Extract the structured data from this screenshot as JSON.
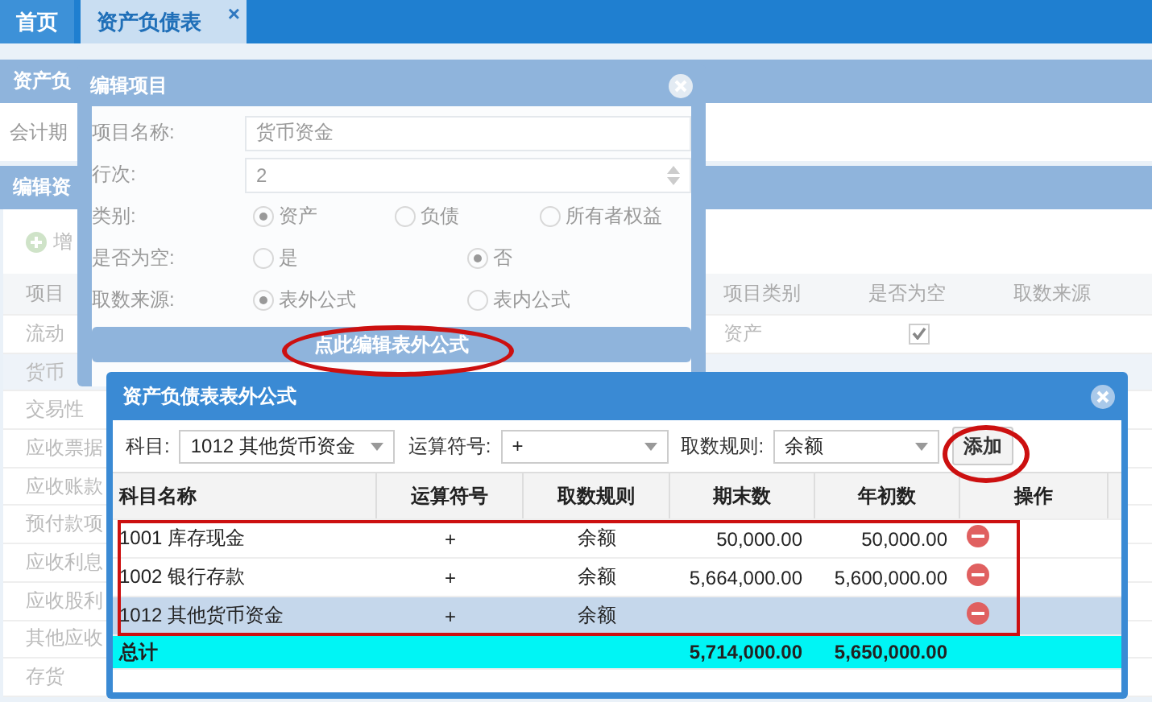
{
  "tabs": [
    {
      "label": "首页",
      "selected": false
    },
    {
      "label": "资产负债表",
      "selected": true,
      "close": "×"
    }
  ],
  "page": {
    "panel_title": "资产负",
    "period_label": "会计期",
    "editor_title": "编辑资",
    "toolbar_button": "增",
    "grid": {
      "columns": [
        "项目",
        "项目类别",
        "是否为空",
        "取数来源"
      ],
      "rows": [
        {
          "name": "流动",
          "selected": false,
          "type": "资产",
          "checked": true
        },
        {
          "name": "货币",
          "selected": true
        },
        {
          "name": "交易性",
          "selected": false
        },
        {
          "name": "应收票据",
          "selected": false
        },
        {
          "name": "应收账款",
          "selected": false
        },
        {
          "name": "预付款项",
          "selected": false
        },
        {
          "name": "应收利息",
          "selected": false
        },
        {
          "name": "应收股利",
          "selected": false
        },
        {
          "name": "其他应收",
          "selected": false
        },
        {
          "name": "存货",
          "selected": false
        }
      ]
    }
  },
  "item_dialog": {
    "title": "编辑项目",
    "fields": [
      {
        "kind": "text",
        "label": "项目名称:",
        "value": "货币资金"
      },
      {
        "kind": "number",
        "label": "行次:",
        "value": "2"
      },
      {
        "kind": "radio",
        "label": "类别:",
        "options": [
          {
            "label": "资产",
            "selected": true
          },
          {
            "label": "负债",
            "selected": false
          },
          {
            "label": "所有者权益",
            "selected": false
          }
        ]
      },
      {
        "kind": "radio",
        "label": "是否为空:",
        "options": [
          {
            "label": "是",
            "selected": false
          },
          {
            "label": "否",
            "selected": true
          }
        ]
      },
      {
        "kind": "radio",
        "label": "取数来源:",
        "options": [
          {
            "label": "表外公式",
            "selected": true
          },
          {
            "label": "表内公式",
            "selected": false
          }
        ]
      }
    ],
    "button": "点此编辑表外公式"
  },
  "formula_dialog": {
    "title": "资产负债表表外公式",
    "filters": [
      {
        "label": "科目:",
        "value": "1012 其他货币资金"
      },
      {
        "label": "运算符号:",
        "value": "+"
      },
      {
        "label": "取数规则:",
        "value": "余额"
      }
    ],
    "add_button": "添加",
    "columns": [
      "科目名称",
      "运算符号",
      "取数规则",
      "期末数",
      "年初数",
      "操作"
    ],
    "rows": [
      {
        "account": "1001 库存现金",
        "operator": "+",
        "rule": "余额",
        "closing": "50,000.00",
        "opening": "50,000.00",
        "selected": false
      },
      {
        "account": "1002 银行存款",
        "operator": "+",
        "rule": "余额",
        "closing": "5,664,000.00",
        "opening": "5,600,000.00",
        "selected": false
      },
      {
        "account": "1012 其他货币资金",
        "operator": "+",
        "rule": "余额",
        "selected": true
      }
    ],
    "total": {
      "label": "总计",
      "closing": "5,714,000.00",
      "opening": "5,650,000.00"
    }
  }
}
